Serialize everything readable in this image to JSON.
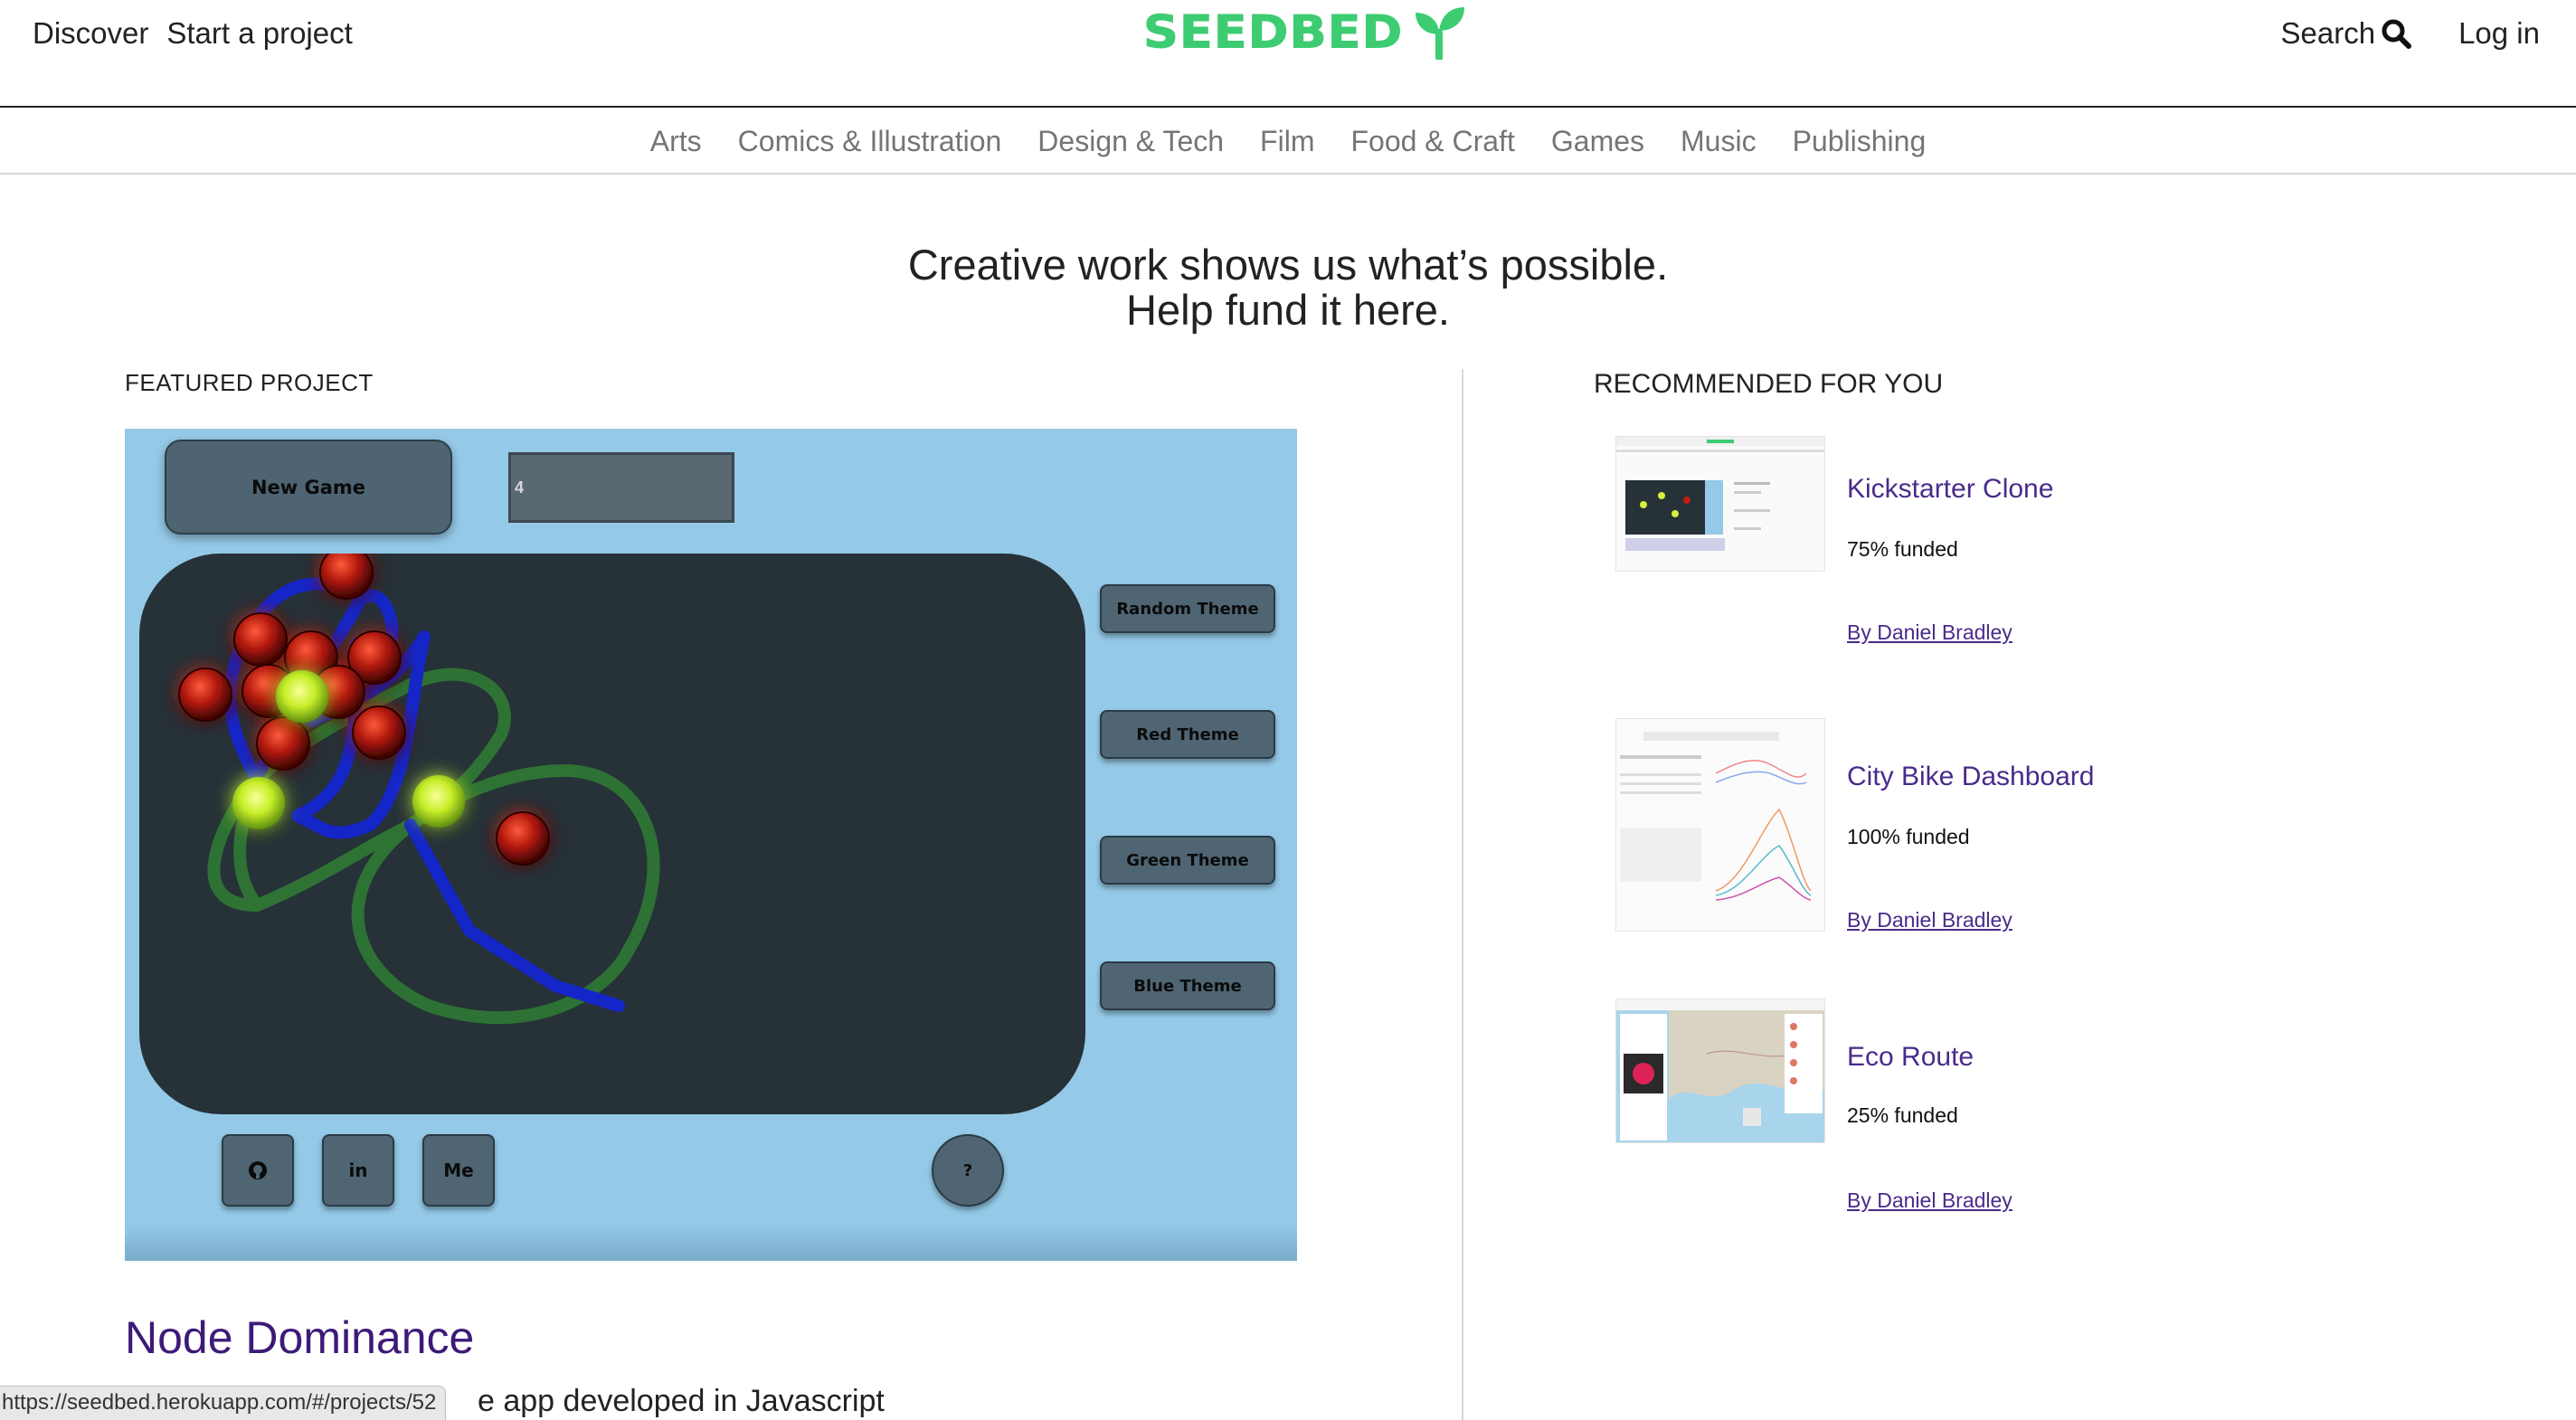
{
  "header": {
    "nav_left": [
      "Discover",
      "Start a project"
    ],
    "logo_text": "SEEDBED",
    "search_label": "Search",
    "login_label": "Log in",
    "brand_color": "#3dcc72"
  },
  "categories": [
    "Arts",
    "Comics & Illustration",
    "Design & Tech",
    "Film",
    "Food & Craft",
    "Games",
    "Music",
    "Publishing"
  ],
  "hero": {
    "line1": "Creative work shows us what’s possible.",
    "line2": "Help fund it here."
  },
  "featured": {
    "label": "FEATURED PROJECT",
    "title": "Node Dominance",
    "description_visible": "e app developed in Javascript",
    "game": {
      "new_game_label": "New Game",
      "count_value": "4",
      "theme_buttons": [
        "Random Theme",
        "Red Theme",
        "Green Theme",
        "Blue Theme"
      ],
      "social_buttons": [
        {
          "label": "",
          "icon": "github-icon"
        },
        {
          "label": "in",
          "icon": "linkedin-icon"
        },
        {
          "label": "Me",
          "icon": "portfolio-icon"
        }
      ],
      "help_label": "?"
    }
  },
  "status_bar_url": "https://seedbed.herokuapp.com/#/projects/52",
  "recommended": {
    "label": "RECOMMENDED FOR YOU",
    "items": [
      {
        "title": "Kickstarter Clone",
        "funded": "75% funded",
        "author": "By Daniel Bradley"
      },
      {
        "title": "City Bike Dashboard",
        "funded": "100% funded",
        "author": "By Daniel Bradley"
      },
      {
        "title": "Eco Route",
        "funded": "25% funded",
        "author": "By Daniel Bradley"
      }
    ]
  }
}
